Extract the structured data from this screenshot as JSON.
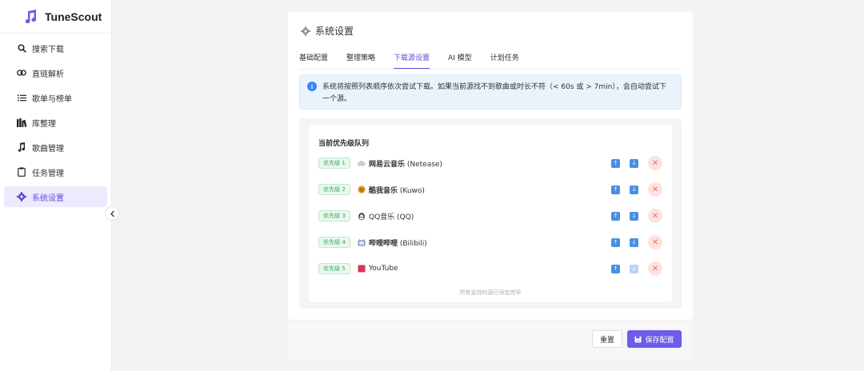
{
  "app": {
    "name": "TuneScout"
  },
  "sidebar": {
    "items": [
      {
        "label": "搜索下载",
        "icon": "search-icon"
      },
      {
        "label": "直链解析",
        "icon": "link-icon"
      },
      {
        "label": "歌单与榜单",
        "icon": "list-icon"
      },
      {
        "label": "库整理",
        "icon": "library-icon"
      },
      {
        "label": "歌曲管理",
        "icon": "music-note-icon"
      },
      {
        "label": "任务管理",
        "icon": "clipboard-icon"
      },
      {
        "label": "系统设置",
        "icon": "gear-icon",
        "active": true
      }
    ]
  },
  "settings": {
    "title": "系统设置",
    "tabs": [
      {
        "label": "基础配置"
      },
      {
        "label": "整理策略"
      },
      {
        "label": "下载源设置",
        "active": true
      },
      {
        "label": "AI 模型"
      },
      {
        "label": "计划任务"
      }
    ],
    "info_text": "系统将按照列表顺序依次尝试下载。如果当前源找不到歌曲或时长不符（< 60s 或 > 7min），会自动尝试下一个源。",
    "queue": {
      "title": "当前优先级队列",
      "rows": [
        {
          "badge": "优先级 1",
          "name": "网易云音乐",
          "suffix": " (Netease)",
          "bold": true,
          "icon": "cloud-icon"
        },
        {
          "badge": "优先级 2",
          "name": "酷我音乐",
          "suffix": " (Kuwo)",
          "bold": true,
          "icon": "kuwo-icon"
        },
        {
          "badge": "优先级 3",
          "name": "QQ音乐",
          "suffix": " (QQ)",
          "bold": false,
          "icon": "penguin-icon"
        },
        {
          "badge": "优先级 4",
          "name": "哔哩哔哩",
          "suffix": " (Bilibili)",
          "bold": true,
          "icon": "tv-icon"
        },
        {
          "badge": "优先级 5",
          "name": "YouTube",
          "suffix": "",
          "bold": false,
          "icon": "youtube-icon"
        }
      ],
      "footer": "所有支持的源已添加完毕"
    },
    "reset_label": "重置",
    "save_label": "保存配置"
  },
  "colors": {
    "accent": "#6c5ce7",
    "info": "#3b82f6",
    "success": "#3aa35a",
    "danger": "#f56c6c"
  }
}
